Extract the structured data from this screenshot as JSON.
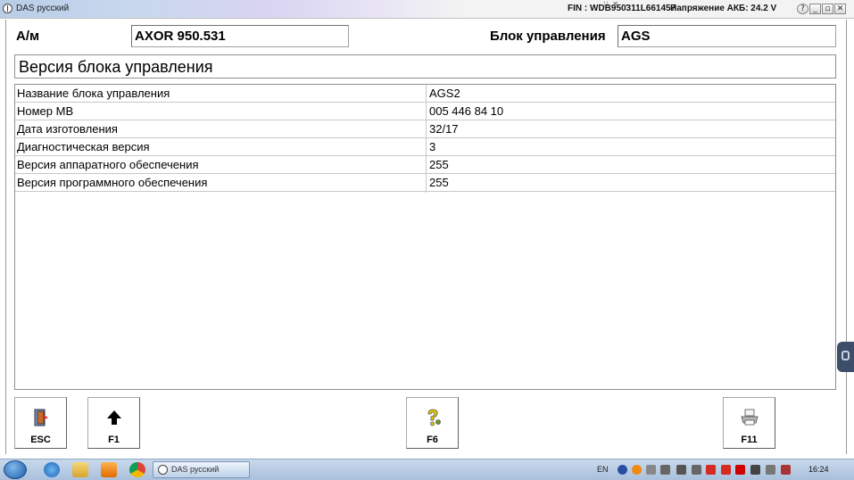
{
  "window": {
    "title": "DAS русский",
    "fin": "FIN : WDB950311L661457",
    "voltage": "Напряжение АКБ: 24.2 V",
    "dots": "⁝⁝  ✕  ⌄"
  },
  "header": {
    "vehicle_label": "А/м",
    "vehicle_value": "AXOR 950.531",
    "control_unit_label": "Блок управления",
    "control_unit_value": "AGS"
  },
  "section_title": "Версия блока управления",
  "rows": [
    {
      "name": "Название блока управления",
      "value": "AGS2"
    },
    {
      "name": "Номер МВ",
      "value": "005 446 84 10"
    },
    {
      "name": "Дата изготовления",
      "value": "32/17"
    },
    {
      "name": "Диагностическая версия",
      "value": "3"
    },
    {
      "name": "Версия аппаратного обеспечения",
      "value": "255"
    },
    {
      "name": "Версия программного обеспечения",
      "value": "255"
    }
  ],
  "function_keys": {
    "esc": {
      "label": "ESC",
      "icon": "exit-door-icon"
    },
    "f1": {
      "label": "F1",
      "icon": "arrow-up-icon"
    },
    "f6": {
      "label": "F6",
      "icon": "help-question-icon"
    },
    "f11": {
      "label": "F11",
      "icon": "printer-icon"
    }
  },
  "taskbar": {
    "task_label": "DAS русский",
    "lang": "EN",
    "clock": "16:24"
  },
  "colors": {
    "accent_tray_red": "#d42a20",
    "accent_tray_orange": "#f08a10",
    "highlight_yellow": "#e8c800"
  }
}
